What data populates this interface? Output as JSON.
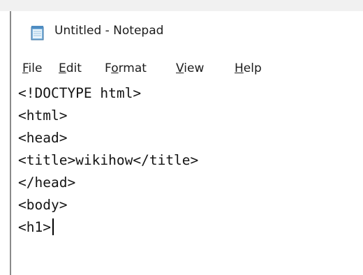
{
  "window": {
    "title": "Untitled - Notepad",
    "icon": "notepad-icon"
  },
  "menubar": {
    "items": [
      {
        "label": "File",
        "mnemonic": "F",
        "rest": "ile"
      },
      {
        "label": "Edit",
        "mnemonic": "E",
        "rest": "dit"
      },
      {
        "label": "Format",
        "pre": "F",
        "mnemonic": "o",
        "rest": "rmat"
      },
      {
        "label": "View",
        "mnemonic": "V",
        "rest": "iew"
      },
      {
        "label": "Help",
        "mnemonic": "H",
        "rest": "elp"
      }
    ]
  },
  "editor": {
    "lines": [
      "<!DOCTYPE html>",
      "<html>",
      "<head>",
      "<title>wikihow</title>",
      "</head>",
      "<body>",
      "<h1>"
    ]
  }
}
